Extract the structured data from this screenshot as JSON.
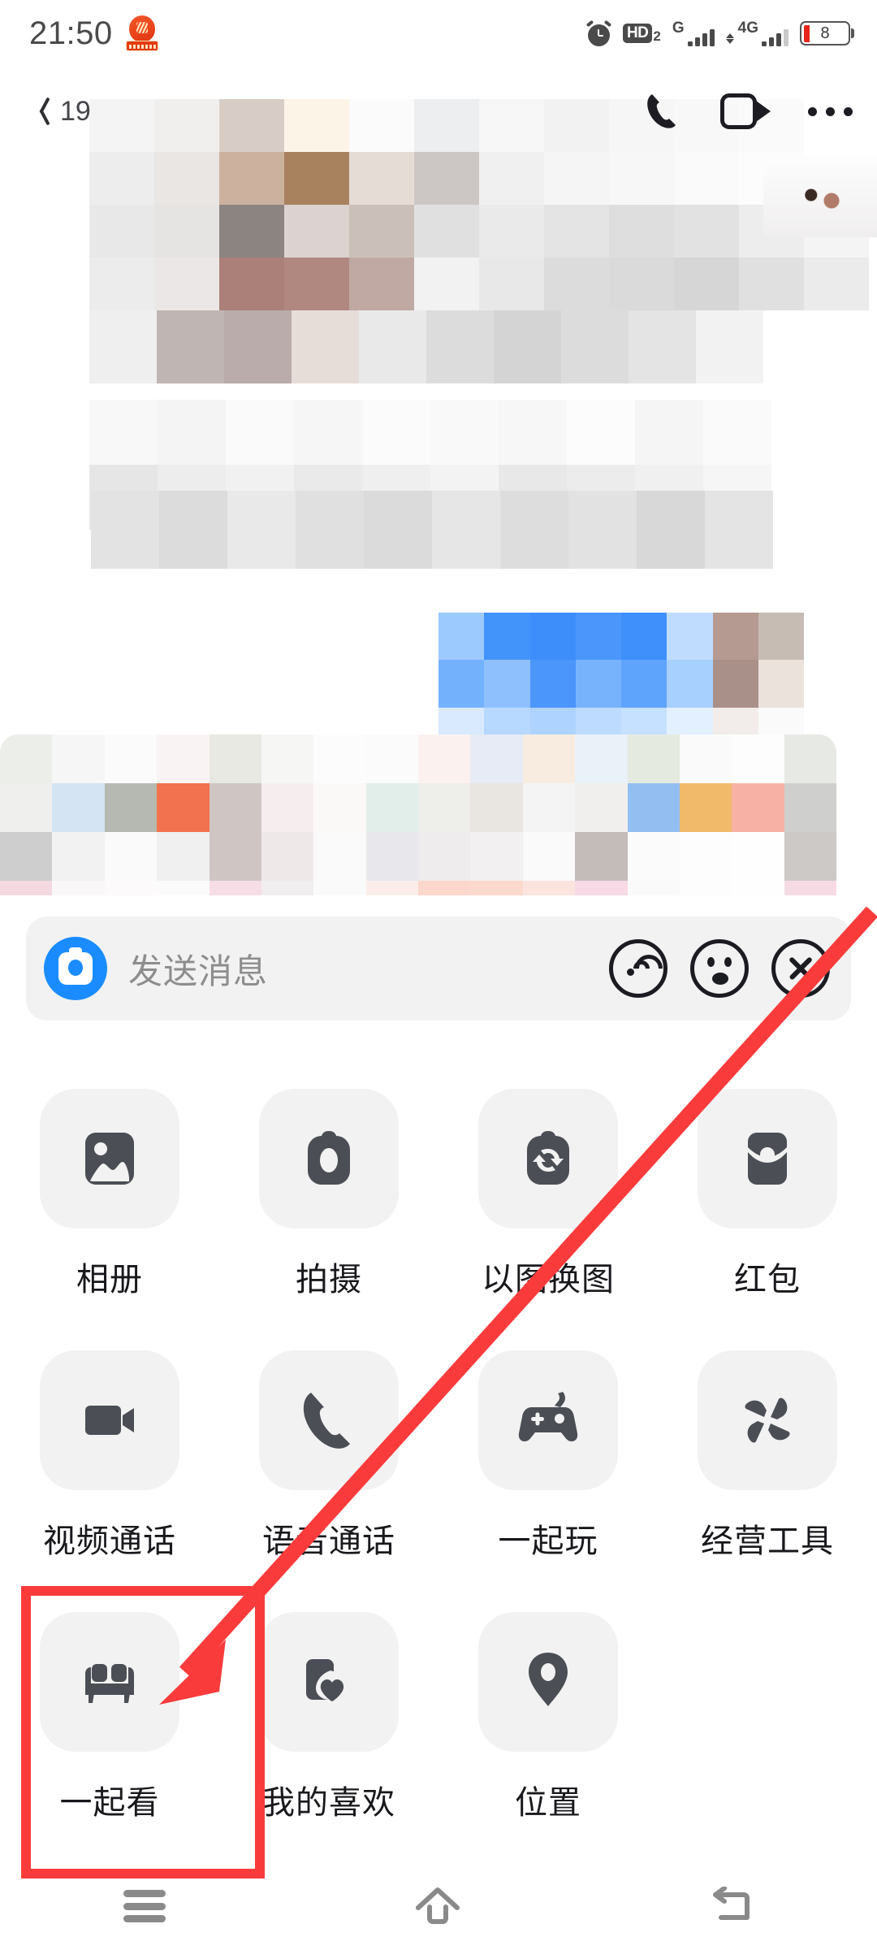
{
  "status_bar": {
    "time": "21:50",
    "notification_icon": "app-notification-icon",
    "alarm_icon": "alarm-clock-icon",
    "hd_label": "HD",
    "hd_sub": "2",
    "sim1_label": "G",
    "sim2_label": "4G",
    "battery_level": "8"
  },
  "nav_bar": {
    "back_icon": "chevron-left-icon",
    "unread_count": "19",
    "phone_icon": "phone-call-icon",
    "video_icon": "video-camera-icon",
    "more_icon": "more-horizontal-icon"
  },
  "chat": {
    "content_state": "mosaic-censored"
  },
  "input_bar": {
    "camera_icon": "camera-circle-icon",
    "placeholder": "发送消息",
    "voice_icon": "voice-wave-icon",
    "emoji_icon": "emoji-face-icon",
    "close_icon": "close-x-icon"
  },
  "panel": {
    "items": [
      {
        "label": "相册",
        "icon": "photo-album-icon"
      },
      {
        "label": "拍摄",
        "icon": "camera-icon"
      },
      {
        "label": "以图换图",
        "icon": "image-swap-icon"
      },
      {
        "label": "红包",
        "icon": "red-packet-icon"
      },
      {
        "label": "视频通话",
        "icon": "video-call-icon"
      },
      {
        "label": "语音通话",
        "icon": "voice-call-icon"
      },
      {
        "label": "一起玩",
        "icon": "gamepad-icon"
      },
      {
        "label": "经营工具",
        "icon": "pinwheel-icon"
      },
      {
        "label": "一起看",
        "icon": "sofa-icon"
      },
      {
        "label": "我的喜欢",
        "icon": "favorite-heart-icon"
      },
      {
        "label": "位置",
        "icon": "location-pin-icon"
      }
    ]
  },
  "annotation": {
    "highlight_target": "一起看",
    "highlight_color": "#f93b3b",
    "arrow_color": "#f93b3b",
    "box_stroke_width": "12"
  },
  "system_nav": {
    "recents_icon": "recents-icon",
    "home_icon": "home-icon",
    "back_icon": "system-back-icon"
  }
}
